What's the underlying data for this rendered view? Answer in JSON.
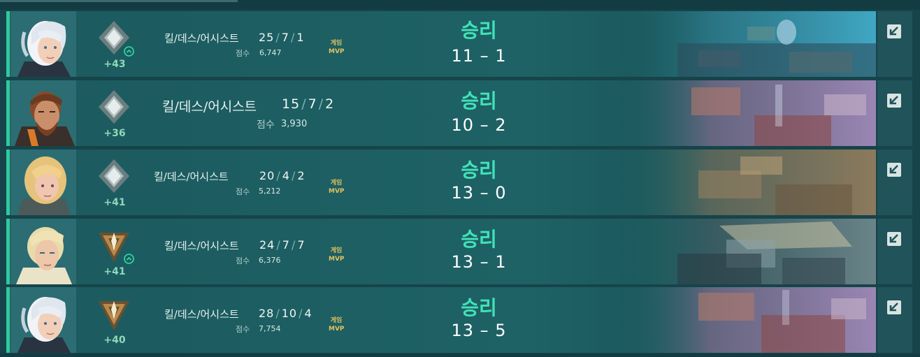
{
  "labels": {
    "kda": "킬/데스/어시스트",
    "score": "점수",
    "mvp_line1": "게임",
    "mvp_line2": "MVP",
    "score_separator": "–"
  },
  "colors": {
    "accent": "#2fc9a0",
    "win": "#41e3b8",
    "rr_gain": "#8fd9b9",
    "mvp": "#e3c25e"
  },
  "matches": [
    {
      "agent": "jett",
      "rank_icon": "silver-diamond",
      "rank_up": true,
      "rr_change": "+43",
      "kills": "25",
      "deaths": "7",
      "assists": "1",
      "score": "6,747",
      "mvp": true,
      "result": "승리",
      "team_score": "11",
      "enemy_score": "1",
      "map_tint": "blue-coastal"
    },
    {
      "agent": "brimstone",
      "rank_icon": "silver-diamond",
      "rank_up": false,
      "rr_change": "+36",
      "kills": "15",
      "deaths": "7",
      "assists": "2",
      "score": "3,930",
      "mvp": false,
      "result": "승리",
      "team_score": "10",
      "enemy_score": "2",
      "map_tint": "purple-town"
    },
    {
      "agent": "sage",
      "rank_icon": "silver-diamond",
      "rank_up": false,
      "rr_change": "+41",
      "kills": "20",
      "deaths": "4",
      "assists": "2",
      "score": "5,212",
      "mvp": true,
      "result": "승리",
      "team_score": "13",
      "enemy_score": "0",
      "map_tint": "tan-desert"
    },
    {
      "agent": "sova",
      "rank_icon": "gold-chevron",
      "rank_up": true,
      "rr_change": "+41",
      "kills": "24",
      "deaths": "7",
      "assists": "7",
      "score": "6,376",
      "mvp": true,
      "result": "승리",
      "team_score": "13",
      "enemy_score": "1",
      "map_tint": "industrial-grey"
    },
    {
      "agent": "jett",
      "rank_icon": "gold-chevron",
      "rank_up": false,
      "rr_change": "+40",
      "kills": "28",
      "deaths": "10",
      "assists": "4",
      "score": "7,754",
      "mvp": true,
      "result": "승리",
      "team_score": "13",
      "enemy_score": "5",
      "map_tint": "purple-town"
    }
  ]
}
